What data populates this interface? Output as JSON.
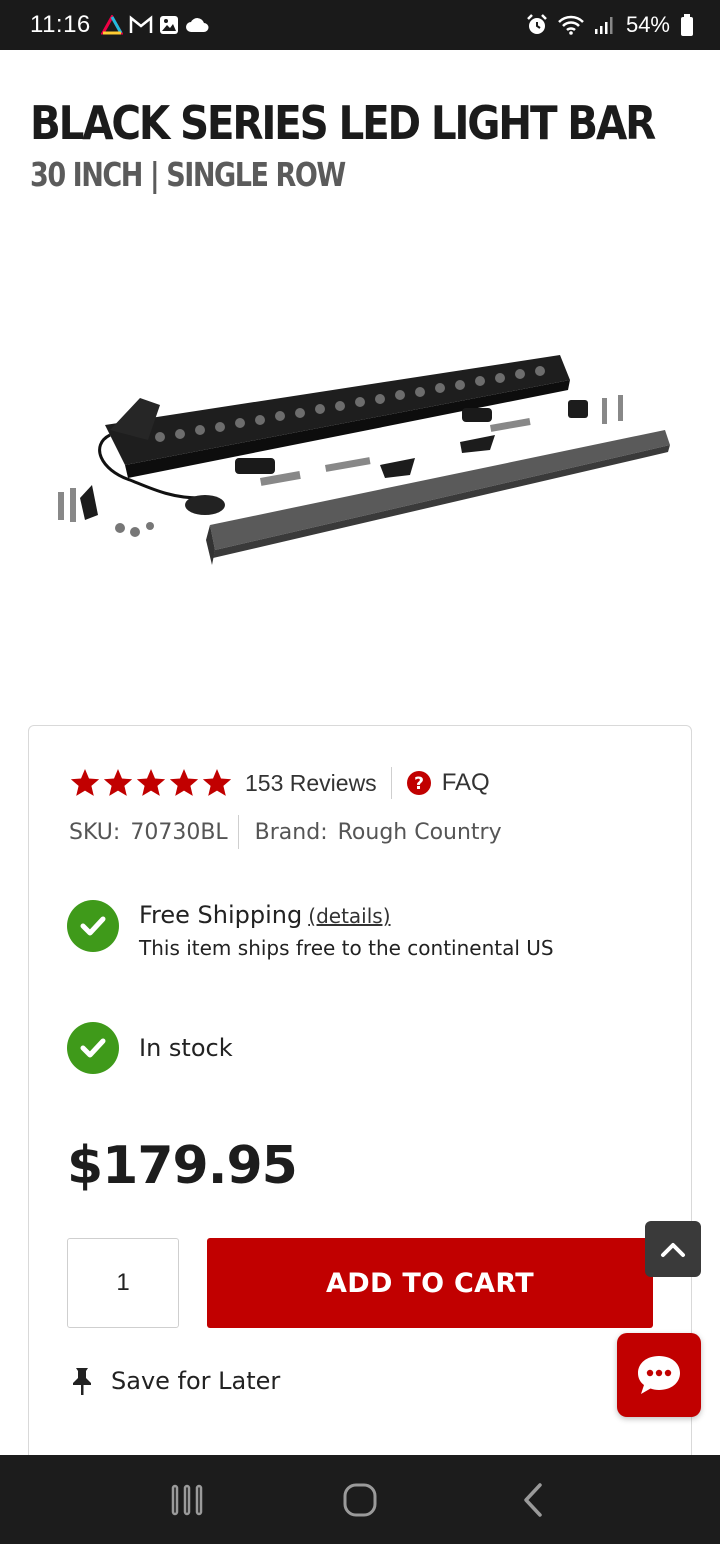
{
  "status_bar": {
    "time": "11:16",
    "battery": "54%",
    "left_icons": [
      "home-icon",
      "gmail-icon",
      "gallery-icon",
      "cloud-icon"
    ],
    "right_icons": [
      "alarm-icon",
      "wifi-icon",
      "signal-icon",
      "battery-icon"
    ]
  },
  "product": {
    "title": "BLACK SERIES LED LIGHT BAR",
    "subtitle": "30 INCH | SINGLE ROW",
    "image_desc_icon": "light-bar-product-image"
  },
  "rating": {
    "stars": 5,
    "star_color": "#c10000",
    "reviews_label": "153 Reviews",
    "faq_label": "FAQ"
  },
  "sku": {
    "sku_label": "SKU:",
    "sku_value": "70730BL",
    "brand_label": "Brand:",
    "brand_value": "Rough Country"
  },
  "shipping": {
    "title": "Free Shipping",
    "details_link": "(details)",
    "subtitle": "This item ships free to the continental US"
  },
  "stock": {
    "label": "In stock"
  },
  "price": "$179.95",
  "cart": {
    "quantity": "1",
    "add_label": "ADD TO CART"
  },
  "save_later": "Save for Later",
  "colors": {
    "accent": "#c10000",
    "check": "#3f9a1a"
  }
}
